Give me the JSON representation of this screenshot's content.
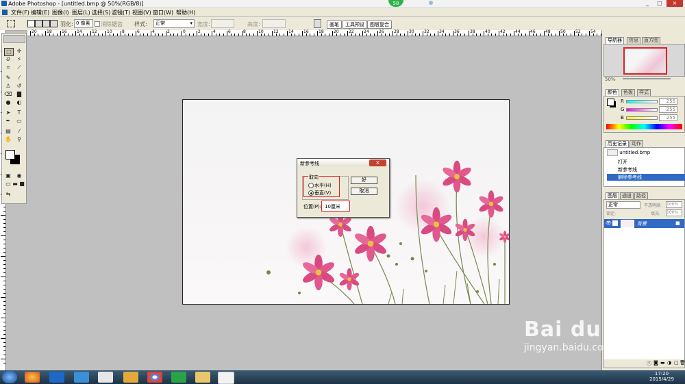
{
  "window": {
    "title": "Adobe Photoshop - [untitled.bmp @ 50%(RGB/8)]",
    "badge": "58",
    "controls": [
      "_",
      "□",
      "×"
    ]
  },
  "menu": [
    "文件(F)",
    "编辑(E)",
    "图像(I)",
    "图层(L)",
    "选择(S)",
    "滤镜(T)",
    "视图(V)",
    "窗口(W)",
    "帮助(H)"
  ],
  "options": {
    "feather_label": "羽化:",
    "feather_value": "0 像素",
    "antialias_label": "消除锯齿",
    "style_label": "样式:",
    "style_value": "正常",
    "width_label": "宽度:",
    "height_label": "高度:",
    "dock_tabs": [
      "画笔",
      "工具预设",
      "图层复合"
    ]
  },
  "ruler_numbers": [
    "20",
    "18",
    "16",
    "14",
    "12",
    "10",
    "8",
    "6",
    "4",
    "2",
    "0",
    "2",
    "4",
    "6",
    "8",
    "10",
    "12",
    "14",
    "16",
    "18",
    "20",
    "22",
    "24",
    "26",
    "28",
    "30",
    "32",
    "34",
    "36",
    "38",
    "40",
    "42",
    "44",
    "46",
    "48",
    "50",
    "52",
    "54"
  ],
  "dialog": {
    "title": "新参考线",
    "close": "×",
    "group_label": "取向",
    "option_horizontal": "水平(H)",
    "option_vertical": "垂直(V)",
    "ok": "好",
    "cancel": "取消",
    "position_label": "位置(P):",
    "position_value": "10厘米"
  },
  "navigator": {
    "tabs": [
      "导航器",
      "信息",
      "直方图"
    ],
    "zoom": "50%"
  },
  "color": {
    "tabs": [
      "颜色",
      "色板",
      "样式"
    ],
    "channels": [
      {
        "name": "R",
        "value": "255"
      },
      {
        "name": "G",
        "value": "255"
      },
      {
        "name": "B",
        "value": "255"
      }
    ]
  },
  "history": {
    "tabs": [
      "历史记录",
      "动作"
    ],
    "snapshot": "untitled.bmp",
    "items": [
      "打开",
      "新参考线",
      "删除参考线"
    ]
  },
  "layers": {
    "tabs": [
      "图层",
      "通道",
      "路径"
    ],
    "blend_mode": "正常",
    "opacity_label": "不透明度:",
    "opacity_value": "100%",
    "lock_label": "锁定:",
    "fill_label": "填充:",
    "fill_value": "100%",
    "layer_name": "背景"
  },
  "taskbar": {
    "time": "17:20",
    "date": "2015/4/29"
  },
  "watermark": {
    "brand": "Bai du 经验",
    "url": "jingyan.baidu.com"
  },
  "colors": {
    "selection": "#316ac5",
    "dialog_highlight": "#e0201e",
    "flower_pink": "#d94a82"
  }
}
